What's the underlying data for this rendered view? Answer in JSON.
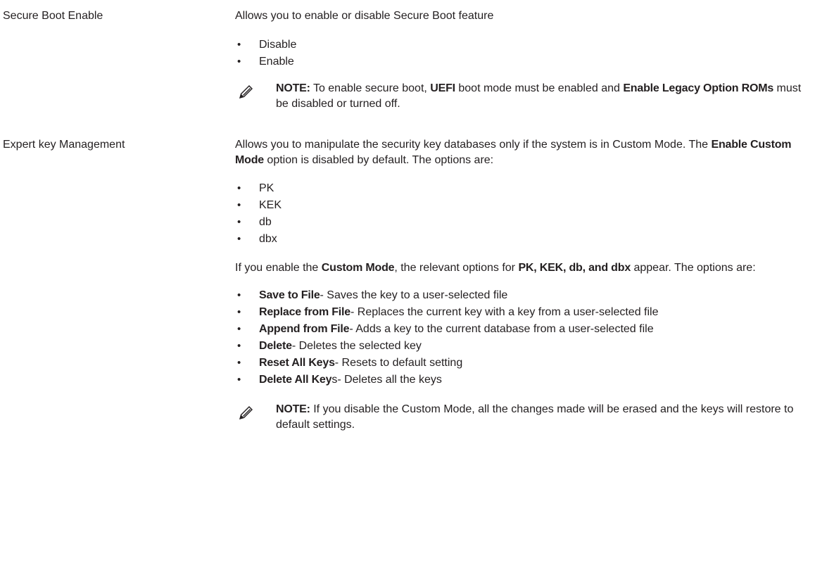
{
  "rows": [
    {
      "label": "Secure Boot Enable",
      "intro": "Allows you to enable or disable Secure Boot feature",
      "options": [
        "Disable",
        "Enable"
      ],
      "note": {
        "prefix": "NOTE:",
        "t1": " To enable secure boot, ",
        "b1": "UEFI",
        "t2": " boot mode must be enabled and ",
        "b2": "Enable Legacy Option ROMs",
        "t3": " must be disabled or turned off."
      }
    },
    {
      "label": "Expert key Management",
      "intro": {
        "t1": "Allows you to manipulate the security key databases only if the system is in Custom Mode. The ",
        "b1": "Enable Custom Mode",
        "t2": " option is disabled by default. The options are:"
      },
      "keys": [
        "PK",
        "KEK",
        "db",
        "dbx"
      ],
      "custom": {
        "t1": "If you enable the ",
        "b1": "Custom Mode",
        "t2": ", the relevant options for ",
        "b2": "PK, KEK, db, and dbx",
        "t3": " appear. The options are:"
      },
      "actions": [
        {
          "name": "Save to File",
          "desc": "- Saves the key to a user-selected file"
        },
        {
          "name": "Replace from File",
          "desc": "- Replaces the current key with a key from a user-selected file"
        },
        {
          "name": "Append from File",
          "desc": "- Adds a key to the current database from a user-selected file"
        },
        {
          "name": "Delete",
          "desc": "- Deletes the selected key"
        },
        {
          "name": "Reset All Keys",
          "desc": "- Resets to default setting"
        },
        {
          "name": "Delete All Key",
          "desc": "s- Deletes all the keys"
        }
      ],
      "note": {
        "prefix": "NOTE:",
        "text": " If you disable the Custom Mode, all the changes made will be erased and the keys will restore to default settings."
      }
    }
  ],
  "bullet_glyph": "•",
  "icons": {
    "note": "pencil-note-icon"
  },
  "colors": {
    "text": "#231f20",
    "background": "#ffffff"
  }
}
